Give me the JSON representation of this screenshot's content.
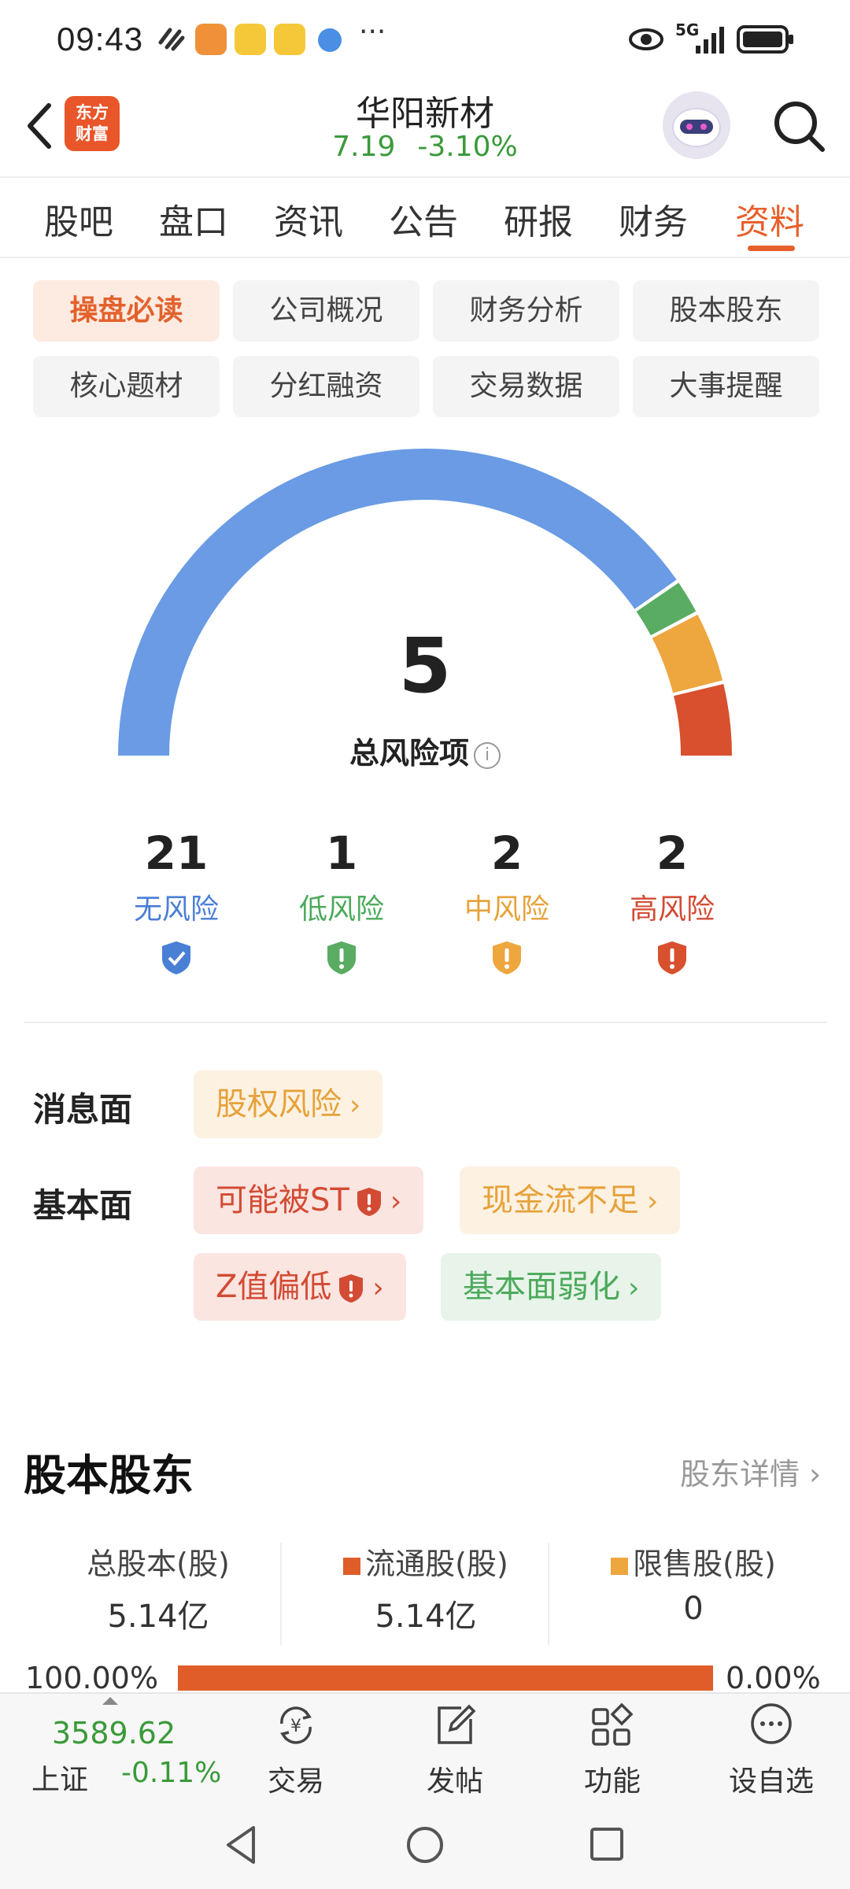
{
  "status_bar": {
    "time": "09:43",
    "network": "5G"
  },
  "header": {
    "logo_line1": "东方",
    "logo_line2": "财富",
    "stock_name": "华阳新材",
    "price": "7.19",
    "change_pct": "-3.10%"
  },
  "tabs": [
    {
      "label": "股吧"
    },
    {
      "label": "盘口"
    },
    {
      "label": "资讯"
    },
    {
      "label": "公告"
    },
    {
      "label": "研报"
    },
    {
      "label": "财务"
    },
    {
      "label": "资料"
    }
  ],
  "active_tab": "资料",
  "sub_tabs": [
    {
      "label": "操盘必读"
    },
    {
      "label": "公司概况"
    },
    {
      "label": "财务分析"
    },
    {
      "label": "股本股东"
    },
    {
      "label": "核心题材"
    },
    {
      "label": "分红融资"
    },
    {
      "label": "交易数据"
    },
    {
      "label": "大事提醒"
    }
  ],
  "gauge": {
    "total": "5",
    "total_label": "总风险项",
    "info_icon": "info-icon",
    "segments": [
      {
        "name": "无风险",
        "value": 21,
        "color": "#6a9be4"
      },
      {
        "name": "低风险",
        "value": 1,
        "color": "#5aac62"
      },
      {
        "name": "中风险",
        "value": 2,
        "color": "#eea63f"
      },
      {
        "name": "高风险",
        "value": 2,
        "color": "#d8502e"
      }
    ]
  },
  "risk_levels": [
    {
      "count": "21",
      "label": "无风险",
      "color": "#4a7fd6",
      "icon": "check-shield-icon"
    },
    {
      "count": "1",
      "label": "低风险",
      "color": "#4caa5b",
      "icon": "warning-shield-icon"
    },
    {
      "count": "2",
      "label": "中风险",
      "color": "#e6a23a",
      "icon": "warning-shield-icon"
    },
    {
      "count": "2",
      "label": "高风险",
      "color": "#d34b34",
      "icon": "warning-shield-icon"
    }
  ],
  "risk_items": {
    "news_label": "消息面",
    "fundamental_label": "基本面",
    "news_tags": [
      {
        "label": "股权风险"
      }
    ],
    "fundamental_tags": [
      {
        "label": "可能被ST"
      },
      {
        "label": "现金流不足"
      },
      {
        "label": "Z值偏低"
      },
      {
        "label": "基本面弱化"
      }
    ]
  },
  "equity": {
    "title": "股本股东",
    "more": "股东详情",
    "cols": [
      {
        "label": "总股本(股)",
        "value": "5.14亿"
      },
      {
        "label": "流通股(股)",
        "value": "5.14亿",
        "color": "#e05d2a"
      },
      {
        "label": "限售股(股)",
        "value": "0",
        "color": "#eea63f"
      }
    ],
    "left_pct": "100.00%",
    "right_pct": "0.00%"
  },
  "bottom_nav": {
    "index_value": "3589.62",
    "index_name": "上证",
    "index_change": "-0.11%",
    "items": [
      {
        "label": "交易",
        "icon": "trade-icon"
      },
      {
        "label": "发帖",
        "icon": "post-icon"
      },
      {
        "label": "功能",
        "icon": "apps-icon"
      },
      {
        "label": "设自选",
        "icon": "more-icon"
      }
    ]
  }
}
